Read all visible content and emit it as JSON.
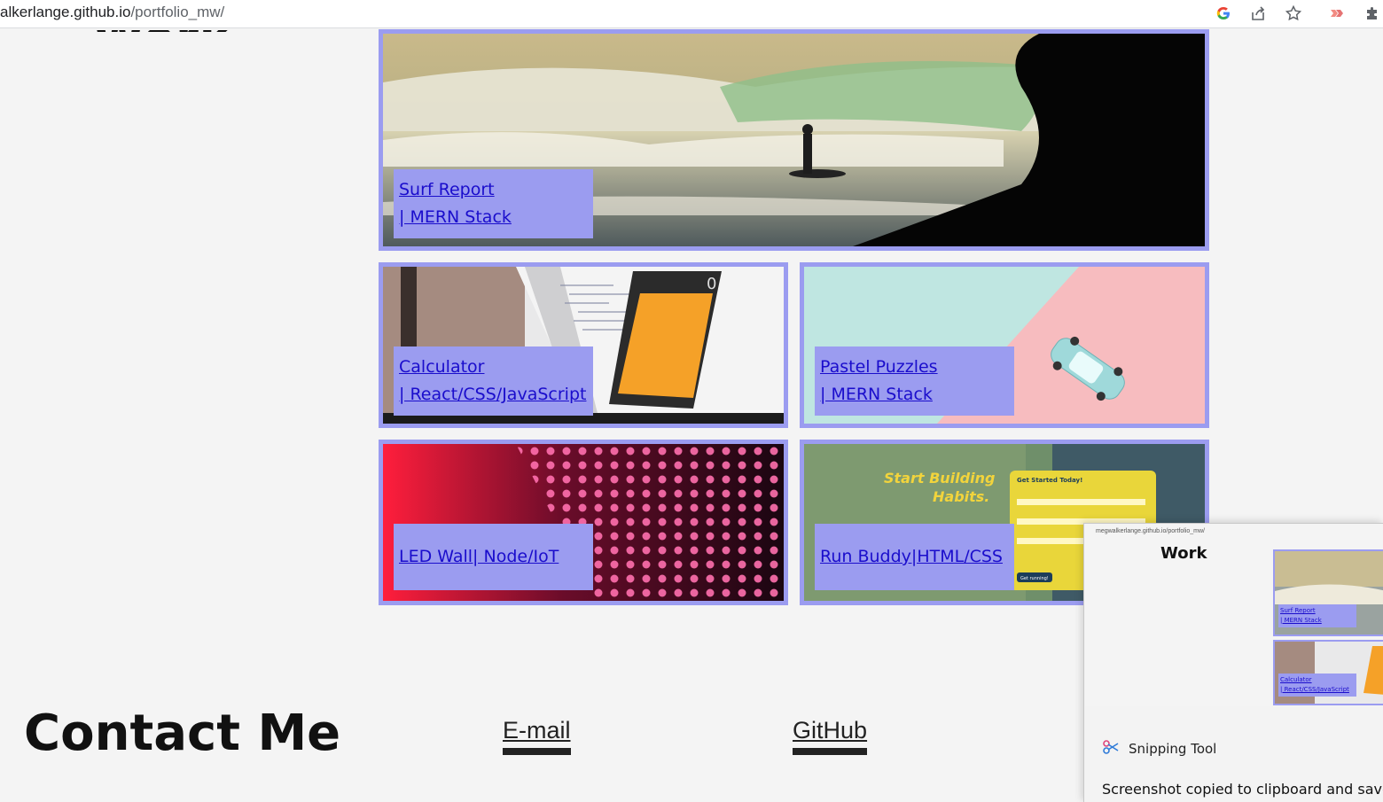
{
  "browser": {
    "url_host": "alkerlange.github.io",
    "url_path": "/portfolio_mw/",
    "icons": [
      "google-icon",
      "share-icon",
      "star-icon",
      "extension-icon",
      "puzzle-icon"
    ]
  },
  "page": {
    "section_title": "Work",
    "projects": [
      {
        "title": "Surf Report",
        "tech": "| MERN Stack"
      },
      {
        "title": "Calculator",
        "tech": "| React/CSS/JavaScript"
      },
      {
        "title": "Pastel Puzzles",
        "tech": "| MERN Stack"
      },
      {
        "title": "LED Wall",
        "tech": "| Node/IoT"
      },
      {
        "title": "Run Buddy",
        "tech": "|HTML/CSS"
      }
    ],
    "run_buddy_image": {
      "headline_1": "Start Building",
      "headline_2": "Habits.",
      "form_title": "Get Started Today!",
      "button": "Get running!"
    },
    "calc_display": "0"
  },
  "contact": {
    "title": "Contact Me",
    "email_label": "E-mail",
    "github_label": "GitHub"
  },
  "snipping_tool": {
    "app_name": "Snipping Tool",
    "message": "Screenshot copied to clipboard and saved",
    "thumb_url": "megwalkerlange.github.io/portfolio_mw/",
    "thumb_title": "Work",
    "thumb_cards": [
      {
        "title": "Surf Report",
        "tech": "| MERN Stack"
      },
      {
        "title": "Calculator",
        "tech": "| React/CSS/JavaScript"
      }
    ]
  },
  "colors": {
    "accent": "#9b9cf0",
    "link": "#1a0dcc",
    "background": "#f4f4f4"
  }
}
